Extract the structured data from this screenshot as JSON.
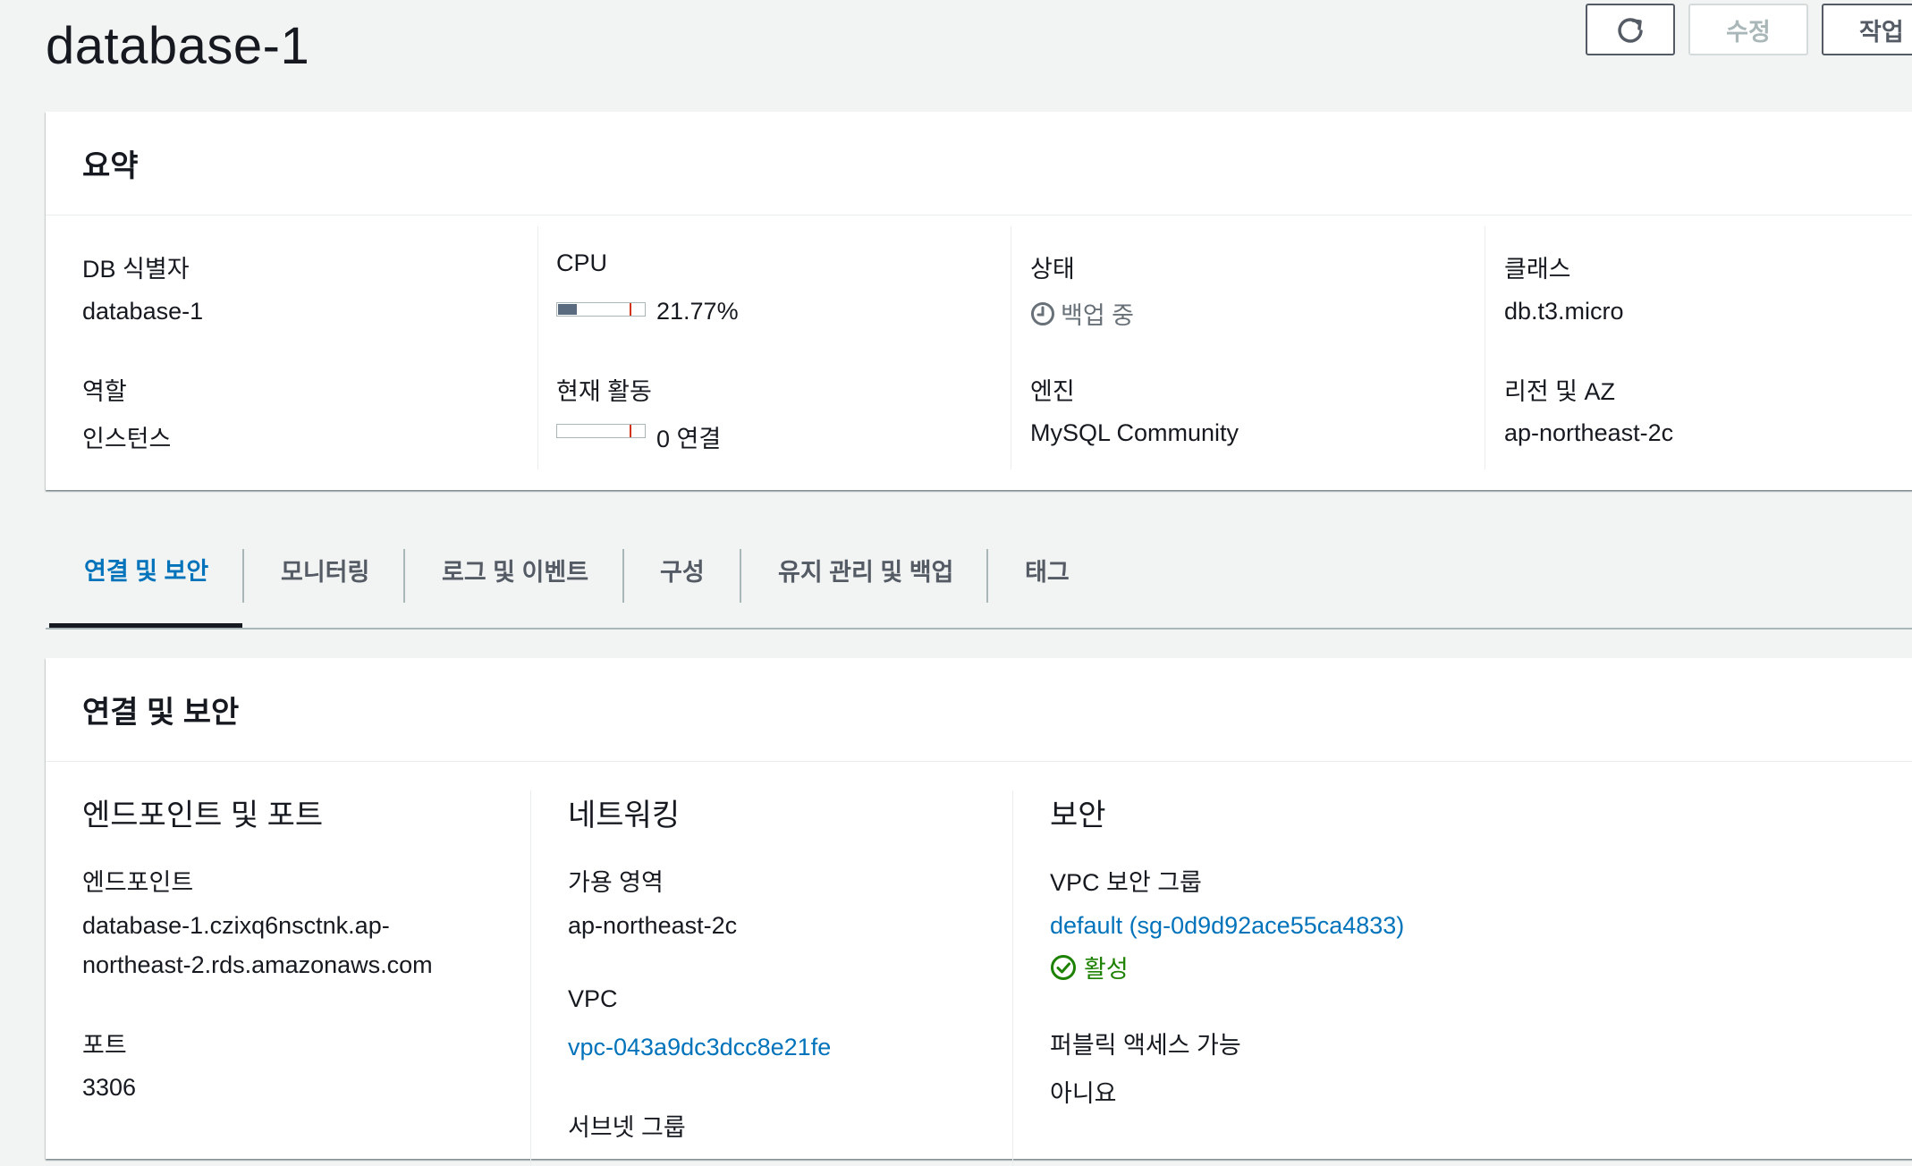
{
  "page": {
    "title": "database-1"
  },
  "actions": {
    "modify_label": "수정",
    "actions_label": "작업"
  },
  "summary": {
    "title": "요약",
    "db_identifier_label": "DB 식별자",
    "db_identifier_value": "database-1",
    "role_label": "역할",
    "role_value": "인스턴스",
    "cpu_label": "CPU",
    "cpu_value": "21.77%",
    "cpu_fraction": 0.2177,
    "activity_label": "현재 활동",
    "activity_value": "0 연결",
    "activity_fraction": 0,
    "status_label": "상태",
    "status_value": "백업 중",
    "engine_label": "엔진",
    "engine_value": "MySQL Community",
    "class_label": "클래스",
    "class_value": "db.t3.micro",
    "region_label": "리전 및 AZ",
    "region_value": "ap-northeast-2c"
  },
  "tabs": [
    {
      "label": "연결 및 보안",
      "active": true
    },
    {
      "label": "모니터링"
    },
    {
      "label": "로그 및 이벤트"
    },
    {
      "label": "구성"
    },
    {
      "label": "유지 관리 및 백업"
    },
    {
      "label": "태그"
    }
  ],
  "connectivity": {
    "title": "연결 및 보안",
    "endpoint_section": {
      "title": "엔드포인트 및 포트",
      "endpoint_label": "엔드포인트",
      "endpoint_line1": "database-1.czixq6nsctnk.ap-",
      "endpoint_line2": "northeast-2.rds.amazonaws.com",
      "port_label": "포트",
      "port_value": "3306"
    },
    "networking_section": {
      "title": "네트워킹",
      "az_label": "가용 영역",
      "az_value": "ap-northeast-2c",
      "vpc_label": "VPC",
      "vpc_value": "vpc-043a9dc3dcc8e21fe",
      "subnet_label": "서브넷 그룹"
    },
    "security_section": {
      "title": "보안",
      "sg_label": "VPC 보안 그룹",
      "sg_value": "default (sg-0d9d92ace55ca4833)",
      "sg_status": "활성",
      "public_label": "퍼블릭 액세스 가능",
      "public_value": "아니요"
    }
  },
  "colors": {
    "link": "#0073bb",
    "success": "#1d8102",
    "pending": "#687078",
    "bar_fill": "#5a6b7f",
    "bar_threshold": "#d13212"
  }
}
